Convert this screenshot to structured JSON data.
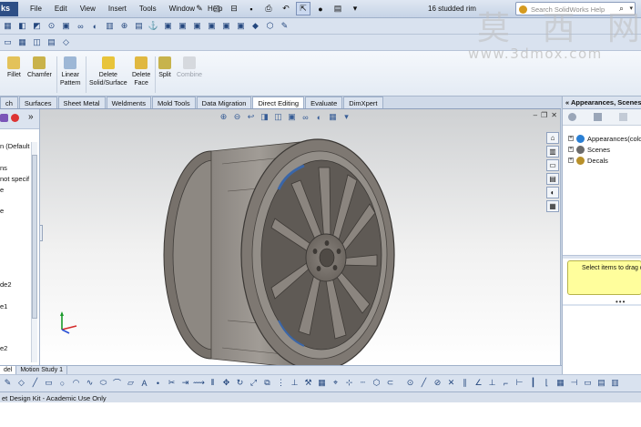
{
  "titlebar": {
    "app_label": "ks",
    "menu": [
      "File",
      "Edit",
      "View",
      "Insert",
      "Tools",
      "Window",
      "Help"
    ],
    "document_title": "16 studded rim",
    "search_placeholder": "Search SolidWorks Help"
  },
  "ribbon": {
    "buttons": [
      {
        "label": "Fillet",
        "icon": "fillet-icon",
        "enabled": true
      },
      {
        "label": "Chamfer",
        "icon": "chamfer-icon",
        "enabled": true
      },
      {
        "label": "Linear\nPattern",
        "icon": "linear-pattern-icon",
        "enabled": true
      },
      {
        "label": "Delete\nSolid/Surface",
        "icon": "delete-solid-icon",
        "enabled": true
      },
      {
        "label": "Delete\nFace",
        "icon": "delete-face-icon",
        "enabled": true
      },
      {
        "label": "Split",
        "icon": "split-icon",
        "enabled": true
      },
      {
        "label": "Combine",
        "icon": "combine-icon",
        "enabled": false
      }
    ]
  },
  "command_tabs": [
    "ch",
    "Surfaces",
    "Sheet Metal",
    "Weldments",
    "Mold Tools",
    "Data Migration",
    "Direct Editing",
    "Evaluate",
    "DimXpert"
  ],
  "active_tab": "Direct Editing",
  "feature_tree": {
    "items": [
      "n  (Default",
      "ns",
      "not specif",
      "e",
      "e",
      "de2",
      "e1",
      "e2"
    ]
  },
  "bottom_tabs": [
    "del",
    "Motion Study 1"
  ],
  "right_panel": {
    "title": "Appearances, Scenes, and Decals",
    "tree": [
      {
        "label": "Appearances(color)",
        "icon": "appearances-icon",
        "color": "#2a7fd4"
      },
      {
        "label": "Scenes",
        "icon": "scenes-icon",
        "color": "#6b6b6b"
      },
      {
        "label": "Decals",
        "icon": "decals-icon",
        "color": "#b8902a"
      }
    ],
    "hint": "Select items to drag or drop"
  },
  "status_bar": "et Design Kit - Academic Use Only",
  "watermark": {
    "cn": "莫 西 网",
    "url": "www.3dmox.com"
  },
  "colors": {
    "accent": "#2e4f86",
    "rim": "#76706a",
    "highlight_blue": "#3a66a8"
  }
}
